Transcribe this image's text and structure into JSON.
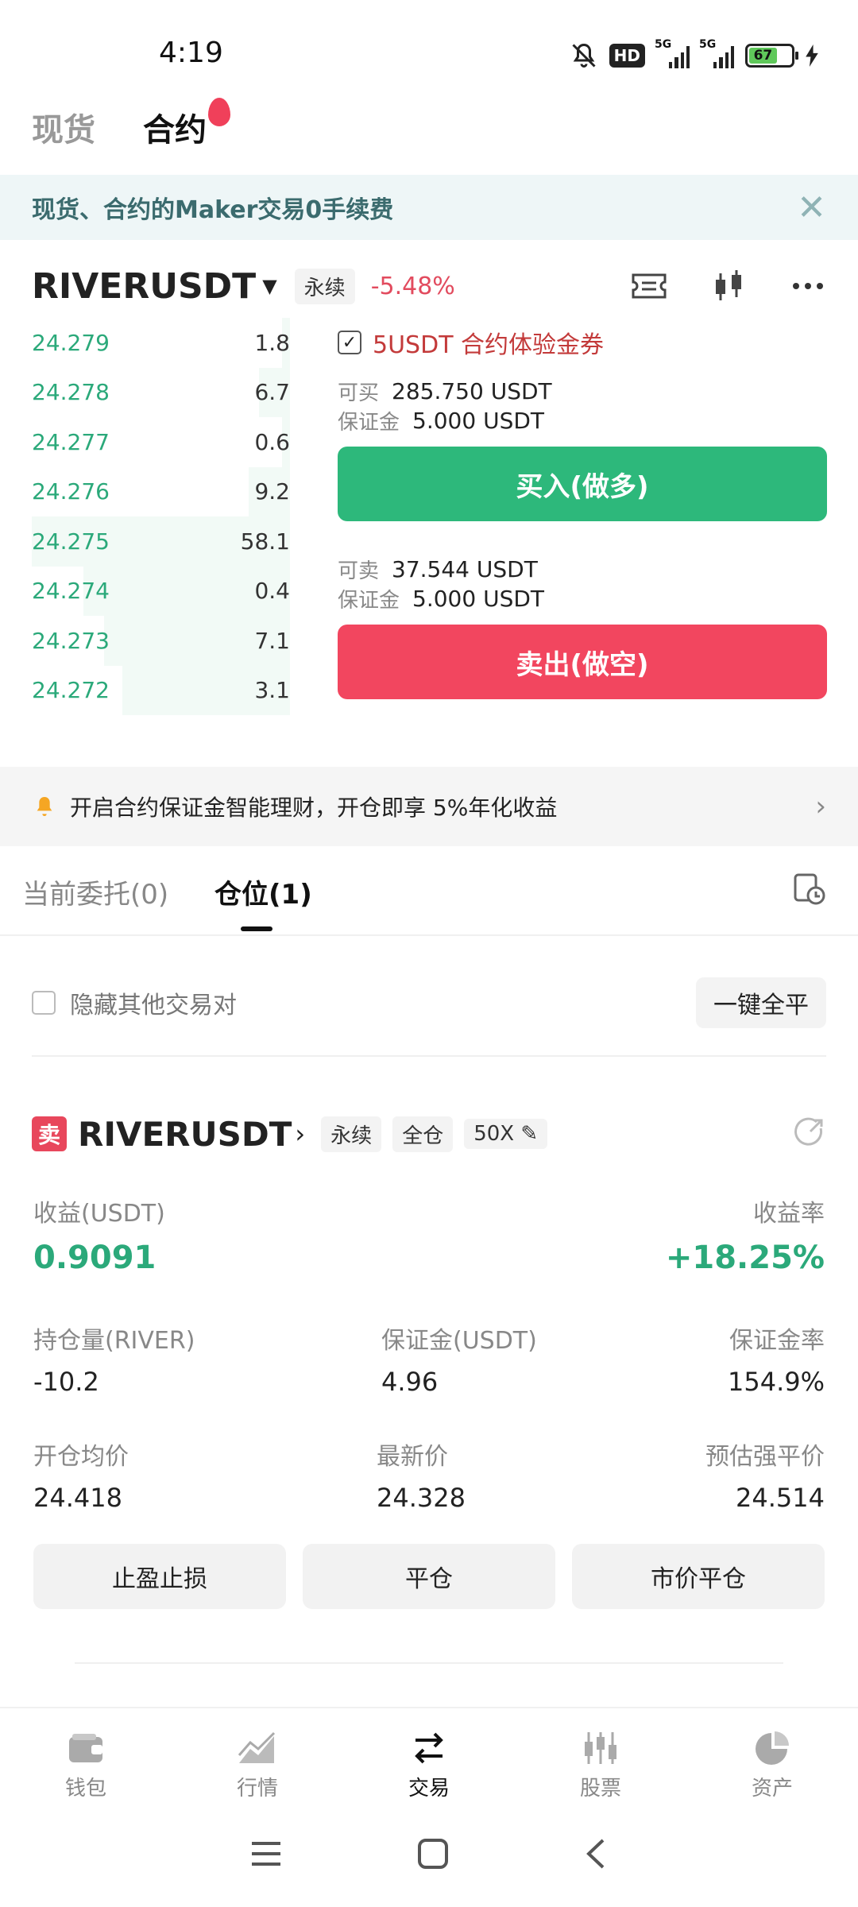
{
  "status": {
    "time": "4:19",
    "hd": "HD",
    "net1": "5G",
    "net2": "5G",
    "battery": "67"
  },
  "main_tabs": [
    {
      "label": "现货"
    },
    {
      "label": "合约"
    }
  ],
  "banner": {
    "text": "现货、合约的Maker交易0手续费"
  },
  "pair": {
    "name": "RIVERUSDT",
    "type_tag": "永续",
    "change": "-5.48%"
  },
  "orderbook": [
    {
      "price": "24.279",
      "qty": "1.8",
      "depth": 0.03
    },
    {
      "price": "24.278",
      "qty": "6.7",
      "depth": 0.12
    },
    {
      "price": "24.277",
      "qty": "0.6",
      "depth": 0.03
    },
    {
      "price": "24.276",
      "qty": "9.2",
      "depth": 0.16
    },
    {
      "price": "24.275",
      "qty": "58.1",
      "depth": 1.0
    },
    {
      "price": "24.274",
      "qty": "0.4",
      "depth": 0.8
    },
    {
      "price": "24.273",
      "qty": "7.1",
      "depth": 0.72
    },
    {
      "price": "24.272",
      "qty": "3.1",
      "depth": 0.65
    }
  ],
  "trade": {
    "voucher": "5USDT 合约体验金券",
    "buy_avail_label": "可买",
    "buy_avail": "285.750 USDT",
    "buy_margin_label": "保证金",
    "buy_margin": "5.000 USDT",
    "buy_button": "买入(做多)",
    "sell_avail_label": "可卖",
    "sell_avail": "37.544 USDT",
    "sell_margin_label": "保证金",
    "sell_margin": "5.000 USDT",
    "sell_button": "卖出(做空)"
  },
  "earn": {
    "text": "开启合约保证金智能理财，开仓即享 5%年化收益"
  },
  "order_tabs": [
    {
      "label": "当前委托(0)"
    },
    {
      "label": "仓位(1)"
    }
  ],
  "hide": {
    "label": "隐藏其他交易对",
    "close_all": "一键全平"
  },
  "position": {
    "side": "卖",
    "name": "RIVERUSDT",
    "tags": [
      "永续",
      "全仓",
      "50X"
    ],
    "pnl_label": "收益(USDT)",
    "pnl": "0.9091",
    "roe_label": "收益率",
    "roe": "+18.25%",
    "size_label": "持仓量(RIVER)",
    "size": "-10.2",
    "margin_label": "保证金(USDT)",
    "margin": "4.96",
    "margin_ratio_label": "保证金率",
    "margin_ratio": "154.9%",
    "entry_label": "开仓均价",
    "entry": "24.418",
    "mark_label": "最新价",
    "mark": "24.328",
    "liq_label": "预估强平价",
    "liq": "24.514",
    "actions": [
      "止盈止损",
      "平仓",
      "市价平仓"
    ]
  },
  "nav": [
    {
      "label": "钱包",
      "icon": "wallet-icon"
    },
    {
      "label": "行情",
      "icon": "chart-icon"
    },
    {
      "label": "交易",
      "icon": "swap-icon"
    },
    {
      "label": "股票",
      "icon": "stock-icon"
    },
    {
      "label": "资产",
      "icon": "pie-icon"
    }
  ],
  "colors": {
    "green": "#2db87b",
    "red": "#f2465f",
    "price_green": "#2ba97a"
  }
}
